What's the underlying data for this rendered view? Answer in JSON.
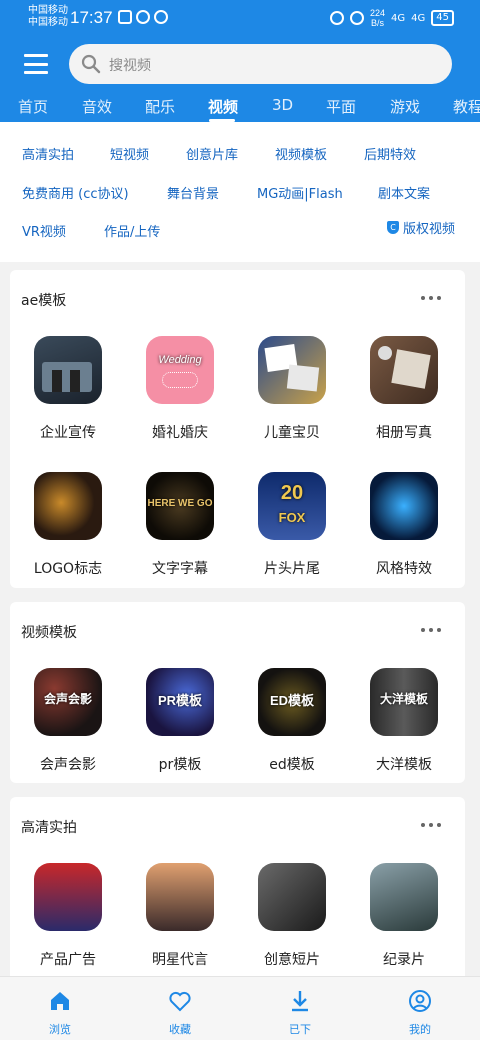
{
  "status": {
    "carrier1": "中国移动",
    "carrier2": "中国移动",
    "time": "17:37",
    "speed_value": "224",
    "speed_unit": "B/s",
    "net1": "4G",
    "net2": "4G",
    "battery": "45",
    "icons": [
      "shield-icon",
      "headset-icon",
      "eye-icon",
      "alarm-icon",
      "mute-icon",
      "signal-icon",
      "battery-icon"
    ]
  },
  "search": {
    "placeholder": "搜视频"
  },
  "tabs": [
    "首页",
    "音效",
    "配乐",
    "视频",
    "3D",
    "平面",
    "游戏",
    "教程"
  ],
  "active_tab": "视频",
  "subnav": {
    "row1": [
      "高清实拍",
      "短视频",
      "创意片库",
      "视频模板",
      "后期特效"
    ],
    "row2": [
      "免费商用 (cc协议)",
      "舞台背景",
      "MG动画|Flash",
      "剧本文案"
    ],
    "row3": [
      "VR视频",
      "作品/上传"
    ],
    "copyright": "版权视频"
  },
  "sections": [
    {
      "title": "ae模板",
      "items": [
        "企业宣传",
        "婚礼婚庆",
        "儿童宝贝",
        "相册写真",
        "LOGO标志",
        "文字字幕",
        "片头片尾",
        "风格特效"
      ]
    },
    {
      "title": "视频模板",
      "items": [
        "会声会影",
        "pr模板",
        "ed模板",
        "大洋模板"
      ]
    },
    {
      "title": "高清实拍",
      "items": [
        "产品广告",
        "明星代言",
        "创意短片",
        "纪录片"
      ]
    }
  ],
  "thumb_texts": {
    "wedding": "Wedding",
    "here_we_go": "HERE WE GO",
    "century_20": "20",
    "century_fox": "FOX",
    "huisheng": "会声会影",
    "pr": "PR模板",
    "ed": "ED模板",
    "dayang": "大洋模板"
  },
  "bottom_nav": [
    "浏览",
    "收藏",
    "已下",
    "我的"
  ],
  "colors": {
    "primary": "#1e88e5",
    "link": "#1565c0"
  }
}
